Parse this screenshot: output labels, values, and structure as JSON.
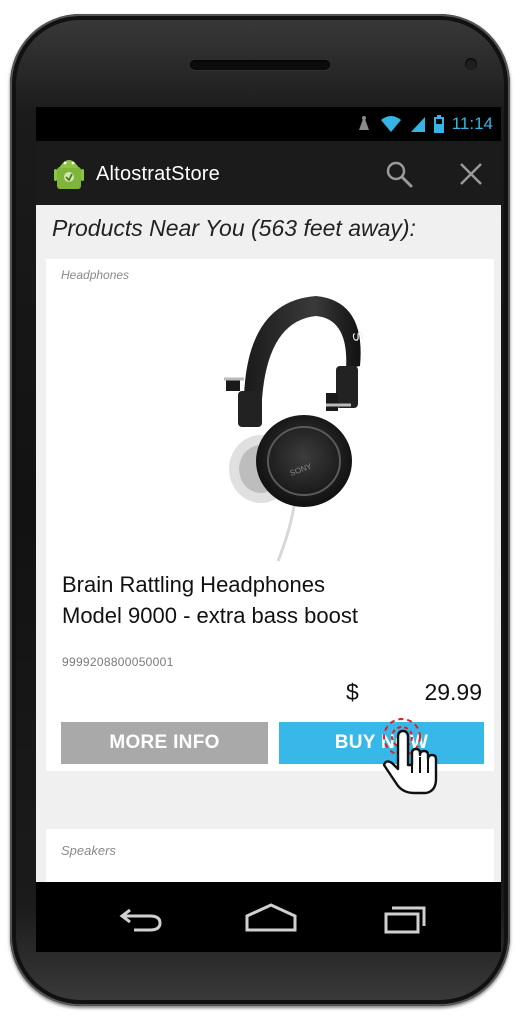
{
  "status_bar": {
    "time": "11:14"
  },
  "app": {
    "title": "AltostratStore"
  },
  "main": {
    "heading": "Products Near You (563 feet away):",
    "products": [
      {
        "category": "Headphones",
        "name_line1": "Brain Rattling Headphones",
        "name_line2": "Model 9000 - extra bass boost",
        "sku": "9999208800050001",
        "currency": "$",
        "price": "29.99",
        "more_info_label": "MORE INFO",
        "buy_now_label": "BUY NOW"
      },
      {
        "category": "Speakers"
      }
    ]
  },
  "colors": {
    "buy_button": "#38b8e8",
    "more_info_button": "#a9a9a9",
    "status_accent": "#35b5e5",
    "android_green": "#8cc641"
  },
  "icons": [
    "android-app-icon",
    "search-icon",
    "close-icon",
    "back-icon",
    "home-icon",
    "recents-icon",
    "wifi-icon",
    "signal-icon",
    "battery-icon",
    "notification-icon",
    "hand-cursor-icon"
  ]
}
